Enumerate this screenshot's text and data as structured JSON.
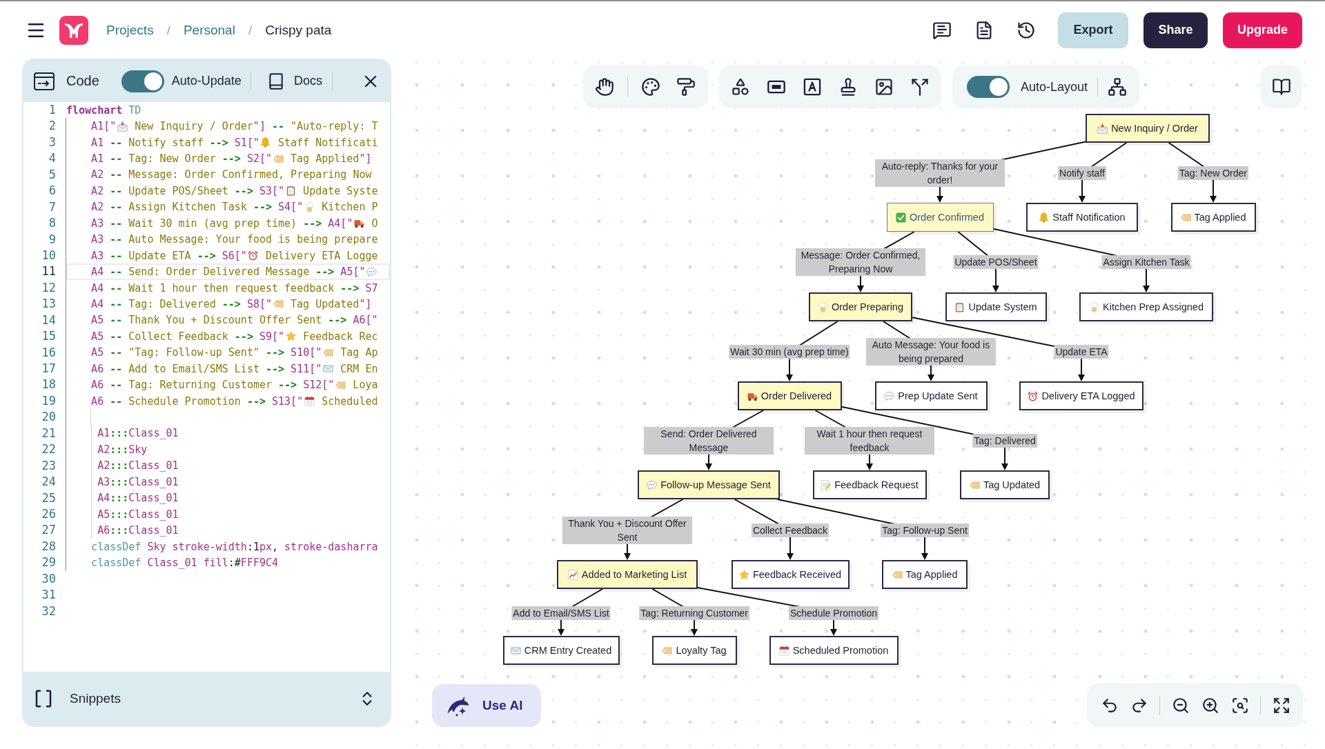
{
  "top_bar": {
    "breadcrumb": [
      {
        "kind": "link",
        "label": "Projects"
      },
      {
        "kind": "separator",
        "label": "/"
      },
      {
        "kind": "link",
        "label": "Personal"
      },
      {
        "kind": "separator",
        "label": "/"
      },
      {
        "kind": "current",
        "label": "Crispy pata"
      }
    ],
    "buttons": [
      {
        "kind": "export",
        "label": "Export"
      },
      {
        "kind": "share",
        "label": "Share"
      },
      {
        "kind": "upgrade",
        "label": "Upgrade"
      }
    ]
  },
  "code_panel": {
    "title": "Code",
    "auto_update": {
      "label": "Auto-Update",
      "on": true
    },
    "docs": "Docs",
    "lines": [
      {
        "number": "1",
        "kind": "top",
        "current": false,
        "tokens": [
          {
            "kind": "keyword",
            "text": "flowchart"
          },
          {
            "kind": "builtin",
            "text": " TD"
          }
        ]
      },
      {
        "number": "2",
        "kind": "body",
        "current": false,
        "tokens": [
          {
            "kind": "id",
            "text": "A1[\""
          },
          {
            "kind": "incoming"
          },
          {
            "kind": "text",
            "text": " New Inquiry / Order"
          },
          {
            "kind": "id",
            "text": "\"]"
          },
          {
            "kind": "arrow",
            "text": " -- "
          },
          {
            "kind": "text",
            "text": "\"Auto-reply: T"
          }
        ]
      },
      {
        "number": "3",
        "kind": "body",
        "current": false,
        "tokens": [
          {
            "kind": "id",
            "text": "A1"
          },
          {
            "kind": "arrow",
            "text": " -- "
          },
          {
            "kind": "text",
            "text": "Notify staff"
          },
          {
            "kind": "arrow",
            "text": " --> "
          },
          {
            "kind": "id",
            "text": "S1[\""
          },
          {
            "kind": "bell"
          },
          {
            "kind": "text",
            "text": " Staff Notificati"
          }
        ]
      },
      {
        "number": "4",
        "kind": "body",
        "current": false,
        "tokens": [
          {
            "kind": "id",
            "text": "A1"
          },
          {
            "kind": "arrow",
            "text": " -- "
          },
          {
            "kind": "text",
            "text": "Tag: New Order"
          },
          {
            "kind": "arrow",
            "text": " --> "
          },
          {
            "kind": "id",
            "text": "S2[\""
          },
          {
            "kind": "tag"
          },
          {
            "kind": "text",
            "text": " Tag Applied"
          },
          {
            "kind": "id",
            "text": "\"]"
          }
        ]
      },
      {
        "number": "5",
        "kind": "body",
        "current": false,
        "tokens": [
          {
            "kind": "id",
            "text": "A2"
          },
          {
            "kind": "arrow",
            "text": " -- "
          },
          {
            "kind": "text",
            "text": "Message: Order Confirmed, Preparing Now"
          }
        ]
      },
      {
        "number": "6",
        "kind": "body",
        "current": false,
        "tokens": [
          {
            "kind": "id",
            "text": "A2"
          },
          {
            "kind": "arrow",
            "text": " -- "
          },
          {
            "kind": "text",
            "text": "Update POS/Sheet"
          },
          {
            "kind": "arrow",
            "text": " --> "
          },
          {
            "kind": "id",
            "text": "S3[\""
          },
          {
            "kind": "clipboard"
          },
          {
            "kind": "text",
            "text": " Update Syste"
          }
        ]
      },
      {
        "number": "7",
        "kind": "body",
        "current": false,
        "tokens": [
          {
            "kind": "id",
            "text": "A2"
          },
          {
            "kind": "arrow",
            "text": " -- "
          },
          {
            "kind": "text",
            "text": "Assign Kitchen Task"
          },
          {
            "kind": "arrow",
            "text": " --> "
          },
          {
            "kind": "id",
            "text": "S4[\""
          },
          {
            "kind": "chef"
          },
          {
            "kind": "text",
            "text": " Kitchen P"
          }
        ]
      },
      {
        "number": "8",
        "kind": "body",
        "current": false,
        "tokens": [
          {
            "kind": "id",
            "text": "A3"
          },
          {
            "kind": "arrow",
            "text": " -- "
          },
          {
            "kind": "text",
            "text": "Wait 30 min (avg prep time)"
          },
          {
            "kind": "arrow",
            "text": " --> "
          },
          {
            "kind": "id",
            "text": "A4[\""
          },
          {
            "kind": "truck"
          },
          {
            "kind": "text",
            "text": " O"
          }
        ]
      },
      {
        "number": "9",
        "kind": "body",
        "current": false,
        "tokens": [
          {
            "kind": "id",
            "text": "A3"
          },
          {
            "kind": "arrow",
            "text": " -- "
          },
          {
            "kind": "text",
            "text": "Auto Message: Your food is being prepare"
          }
        ]
      },
      {
        "number": "10",
        "kind": "body",
        "current": false,
        "tokens": [
          {
            "kind": "id",
            "text": "A3"
          },
          {
            "kind": "arrow",
            "text": " -- "
          },
          {
            "kind": "text",
            "text": "Update ETA"
          },
          {
            "kind": "arrow",
            "text": " --> "
          },
          {
            "kind": "id",
            "text": "S6[\""
          },
          {
            "kind": "alarm"
          },
          {
            "kind": "text",
            "text": " Delivery ETA Logge"
          }
        ]
      },
      {
        "number": "11",
        "kind": "body",
        "current": true,
        "tokens": [
          {
            "kind": "id",
            "text": "A4"
          },
          {
            "kind": "arrow",
            "text": " -- "
          },
          {
            "kind": "text",
            "text": "Send: Order Delivered Message"
          },
          {
            "kind": "arrow",
            "text": " --> "
          },
          {
            "kind": "id",
            "text": "A5[\""
          },
          {
            "kind": "speech"
          }
        ]
      },
      {
        "number": "12",
        "kind": "body",
        "current": false,
        "tokens": [
          {
            "kind": "id",
            "text": "A4"
          },
          {
            "kind": "arrow",
            "text": " -- "
          },
          {
            "kind": "text",
            "text": "Wait 1 hour then request feedback"
          },
          {
            "kind": "arrow",
            "text": " --> "
          },
          {
            "kind": "id",
            "text": "S7"
          }
        ]
      },
      {
        "number": "13",
        "kind": "body",
        "current": false,
        "tokens": [
          {
            "kind": "id",
            "text": "A4"
          },
          {
            "kind": "arrow",
            "text": " -- "
          },
          {
            "kind": "text",
            "text": "Tag: Delivered"
          },
          {
            "kind": "arrow",
            "text": " --> "
          },
          {
            "kind": "id",
            "text": "S8[\""
          },
          {
            "kind": "tag"
          },
          {
            "kind": "text",
            "text": " Tag Updated"
          },
          {
            "kind": "id",
            "text": "\"]"
          }
        ]
      },
      {
        "number": "14",
        "kind": "body",
        "current": false,
        "tokens": [
          {
            "kind": "id",
            "text": "A5"
          },
          {
            "kind": "arrow",
            "text": " -- "
          },
          {
            "kind": "text",
            "text": "Thank You + Discount Offer Sent"
          },
          {
            "kind": "arrow",
            "text": " --> "
          },
          {
            "kind": "id",
            "text": "A6[\""
          }
        ]
      },
      {
        "number": "15",
        "kind": "body",
        "current": false,
        "tokens": [
          {
            "kind": "id",
            "text": "A5"
          },
          {
            "kind": "arrow",
            "text": " -- "
          },
          {
            "kind": "text",
            "text": "Collect Feedback"
          },
          {
            "kind": "arrow",
            "text": " --> "
          },
          {
            "kind": "id",
            "text": "S9[\""
          },
          {
            "kind": "star"
          },
          {
            "kind": "text",
            "text": " Feedback Rec"
          }
        ]
      },
      {
        "number": "16",
        "kind": "body",
        "current": false,
        "tokens": [
          {
            "kind": "id",
            "text": "A5"
          },
          {
            "kind": "arrow",
            "text": " -- "
          },
          {
            "kind": "text",
            "text": "\"Tag: Follow-up Sent\""
          },
          {
            "kind": "arrow",
            "text": " --> "
          },
          {
            "kind": "id",
            "text": "S10[\""
          },
          {
            "kind": "tag"
          },
          {
            "kind": "text",
            "text": " Tag Ap"
          }
        ]
      },
      {
        "number": "17",
        "kind": "body",
        "current": false,
        "tokens": [
          {
            "kind": "id",
            "text": "A6"
          },
          {
            "kind": "arrow",
            "text": " -- "
          },
          {
            "kind": "text",
            "text": "Add to Email/SMS List"
          },
          {
            "kind": "arrow",
            "text": " --> "
          },
          {
            "kind": "id",
            "text": "S11[\""
          },
          {
            "kind": "email"
          },
          {
            "kind": "text",
            "text": " CRM En"
          }
        ]
      },
      {
        "number": "18",
        "kind": "body",
        "current": false,
        "tokens": [
          {
            "kind": "id",
            "text": "A6"
          },
          {
            "kind": "arrow",
            "text": " -- "
          },
          {
            "kind": "text",
            "text": "Tag: Returning Customer"
          },
          {
            "kind": "arrow",
            "text": " --> "
          },
          {
            "kind": "id",
            "text": "S12[\""
          },
          {
            "kind": "tag"
          },
          {
            "kind": "text",
            "text": " Loya"
          }
        ]
      },
      {
        "number": "19",
        "kind": "body",
        "current": false,
        "tokens": [
          {
            "kind": "id",
            "text": "A6"
          },
          {
            "kind": "arrow",
            "text": " -- "
          },
          {
            "kind": "text",
            "text": "Schedule Promotion"
          },
          {
            "kind": "arrow",
            "text": " --> "
          },
          {
            "kind": "id",
            "text": "S13[\""
          },
          {
            "kind": "calendar"
          },
          {
            "kind": "text",
            "text": " Scheduled"
          }
        ]
      },
      {
        "number": "20",
        "kind": "nested",
        "current": false
      },
      {
        "number": "21",
        "kind": "nested",
        "current": false,
        "tokens": [
          {
            "kind": "id",
            "text": "A1"
          },
          {
            "kind": "arrow",
            "text": ":::"
          },
          {
            "kind": "id",
            "text": "Class_01"
          }
        ]
      },
      {
        "number": "22",
        "kind": "nested",
        "current": false,
        "tokens": [
          {
            "kind": "id",
            "text": "A2"
          },
          {
            "kind": "arrow",
            "text": ":::"
          },
          {
            "kind": "id",
            "text": "Sky"
          }
        ]
      },
      {
        "number": "23",
        "kind": "nested",
        "current": false,
        "tokens": [
          {
            "kind": "id",
            "text": "A2"
          },
          {
            "kind": "arrow",
            "text": ":::"
          },
          {
            "kind": "id",
            "text": "Class_01"
          }
        ]
      },
      {
        "number": "24",
        "kind": "nested",
        "current": false,
        "tokens": [
          {
            "kind": "id",
            "text": "A3"
          },
          {
            "kind": "arrow",
            "text": ":::"
          },
          {
            "kind": "id",
            "text": "Class_01"
          }
        ]
      },
      {
        "number": "25",
        "kind": "nested",
        "current": false,
        "tokens": [
          {
            "kind": "id",
            "text": "A4"
          },
          {
            "kind": "arrow",
            "text": ":::"
          },
          {
            "kind": "id",
            "text": "Class_01"
          }
        ]
      },
      {
        "number": "26",
        "kind": "nested",
        "current": false,
        "tokens": [
          {
            "kind": "id",
            "text": "A5"
          },
          {
            "kind": "arrow",
            "text": ":::"
          },
          {
            "kind": "id",
            "text": "Class_01"
          }
        ]
      },
      {
        "number": "27",
        "kind": "nested",
        "current": false,
        "tokens": [
          {
            "kind": "id",
            "text": "A6"
          },
          {
            "kind": "arrow",
            "text": ":::"
          },
          {
            "kind": "id",
            "text": "Class_01"
          }
        ]
      },
      {
        "number": "28",
        "kind": "body",
        "current": false,
        "tokens": [
          {
            "kind": "builtin",
            "text": "classDef"
          },
          {
            "kind": "id",
            "text": " Sky stroke-width"
          },
          {
            "kind": "plain",
            "text": ":1"
          },
          {
            "kind": "id",
            "text": "px"
          },
          {
            "kind": "plain",
            "text": ", "
          },
          {
            "kind": "id",
            "text": "stroke-dasharra"
          }
        ]
      },
      {
        "number": "29",
        "kind": "body",
        "current": false,
        "tokens": [
          {
            "kind": "builtin",
            "text": "classDef"
          },
          {
            "kind": "id",
            "text": " Class_01 fill"
          },
          {
            "kind": "plain",
            "text": ":#"
          },
          {
            "kind": "id",
            "text": "FFF9C4"
          }
        ]
      },
      {
        "number": "30",
        "kind": "empty",
        "current": false
      },
      {
        "number": "31",
        "kind": "empty",
        "current": false
      },
      {
        "number": "32",
        "kind": "empty",
        "current": false
      }
    ],
    "snippets": "Snippets"
  },
  "canvas": {
    "auto_layout": {
      "label": "Auto-Layout",
      "on": true
    },
    "diagram": {
      "root": {
        "label": "New Inquiry / Order",
        "color": "#fff9c4",
        "kind": "plain",
        "children": [
          {
            "edge": "Auto-reply: Thanks for your order!",
            "label": "Order Confirmed",
            "color": "#fff9c4",
            "kind": "sky",
            "children": [
              {
                "edge": "Message: Order Confirmed, Preparing Now",
                "label": "Order Preparing",
                "color": "#fff9c4",
                "kind": "plain",
                "children": [
                  {
                    "edge": "Wait 30 min (avg prep time)",
                    "label": "Order Delivered",
                    "color": "#fff9c4",
                    "kind": "plain",
                    "children": [
                      {
                        "edge": "Send: Order Delivered Message",
                        "label": "Follow-up Message Sent",
                        "color": "#fff9c4",
                        "kind": "plain",
                        "children": [
                          {
                            "edge": "Thank You + Discount Offer Sent",
                            "label": "Added to Marketing List",
                            "color": "#fff9c4",
                            "kind": "plain",
                            "children": [
                              {
                                "edge": "Add to Email/SMS List",
                                "label": "CRM Entry Created",
                                "color": "#ffffff",
                                "kind": "plain"
                              },
                              {
                                "edge": "Tag: Returning Customer",
                                "label": "Loyalty Tag",
                                "color": "#ffffff",
                                "kind": "plain"
                              },
                              {
                                "edge": "Schedule Promotion",
                                "label": "Scheduled Promotion",
                                "color": "#ffffff",
                                "kind": "plain"
                              }
                            ]
                          },
                          {
                            "edge": "Collect Feedback",
                            "label": "Feedback Received",
                            "color": "#ffffff",
                            "kind": "plain"
                          },
                          {
                            "edge": "Tag: Follow-up Sent",
                            "label": "Tag Applied",
                            "color": "#ffffff",
                            "kind": "plain"
                          }
                        ]
                      },
                      {
                        "edge": "Wait 1 hour then request feedback",
                        "label": "Feedback Request",
                        "color": "#ffffff",
                        "kind": "plain"
                      },
                      {
                        "edge": "Tag: Delivered",
                        "label": "Tag Updated",
                        "color": "#ffffff",
                        "kind": "plain"
                      }
                    ]
                  },
                  {
                    "edge": "Auto Message: Your food is being prepared",
                    "label": "Prep Update Sent",
                    "color": "#ffffff",
                    "kind": "plain"
                  },
                  {
                    "edge": "Update ETA",
                    "label": "Delivery ETA Logged",
                    "color": "#ffffff",
                    "kind": "plain"
                  }
                ]
              },
              {
                "edge": "Update POS/Sheet",
                "label": "Update System",
                "color": "#ffffff",
                "kind": "plain"
              },
              {
                "edge": "Assign Kitchen Task",
                "label": "Kitchen Prep Assigned",
                "color": "#ffffff",
                "kind": "plain"
              }
            ]
          },
          {
            "edge": "Notify staff",
            "label": "Staff Notification",
            "color": "#ffffff",
            "kind": "plain"
          },
          {
            "edge": "Tag: New Order",
            "label": "Tag Applied",
            "color": "#ffffff",
            "kind": "plain"
          }
        ]
      }
    },
    "ai_button": "Use AI"
  }
}
